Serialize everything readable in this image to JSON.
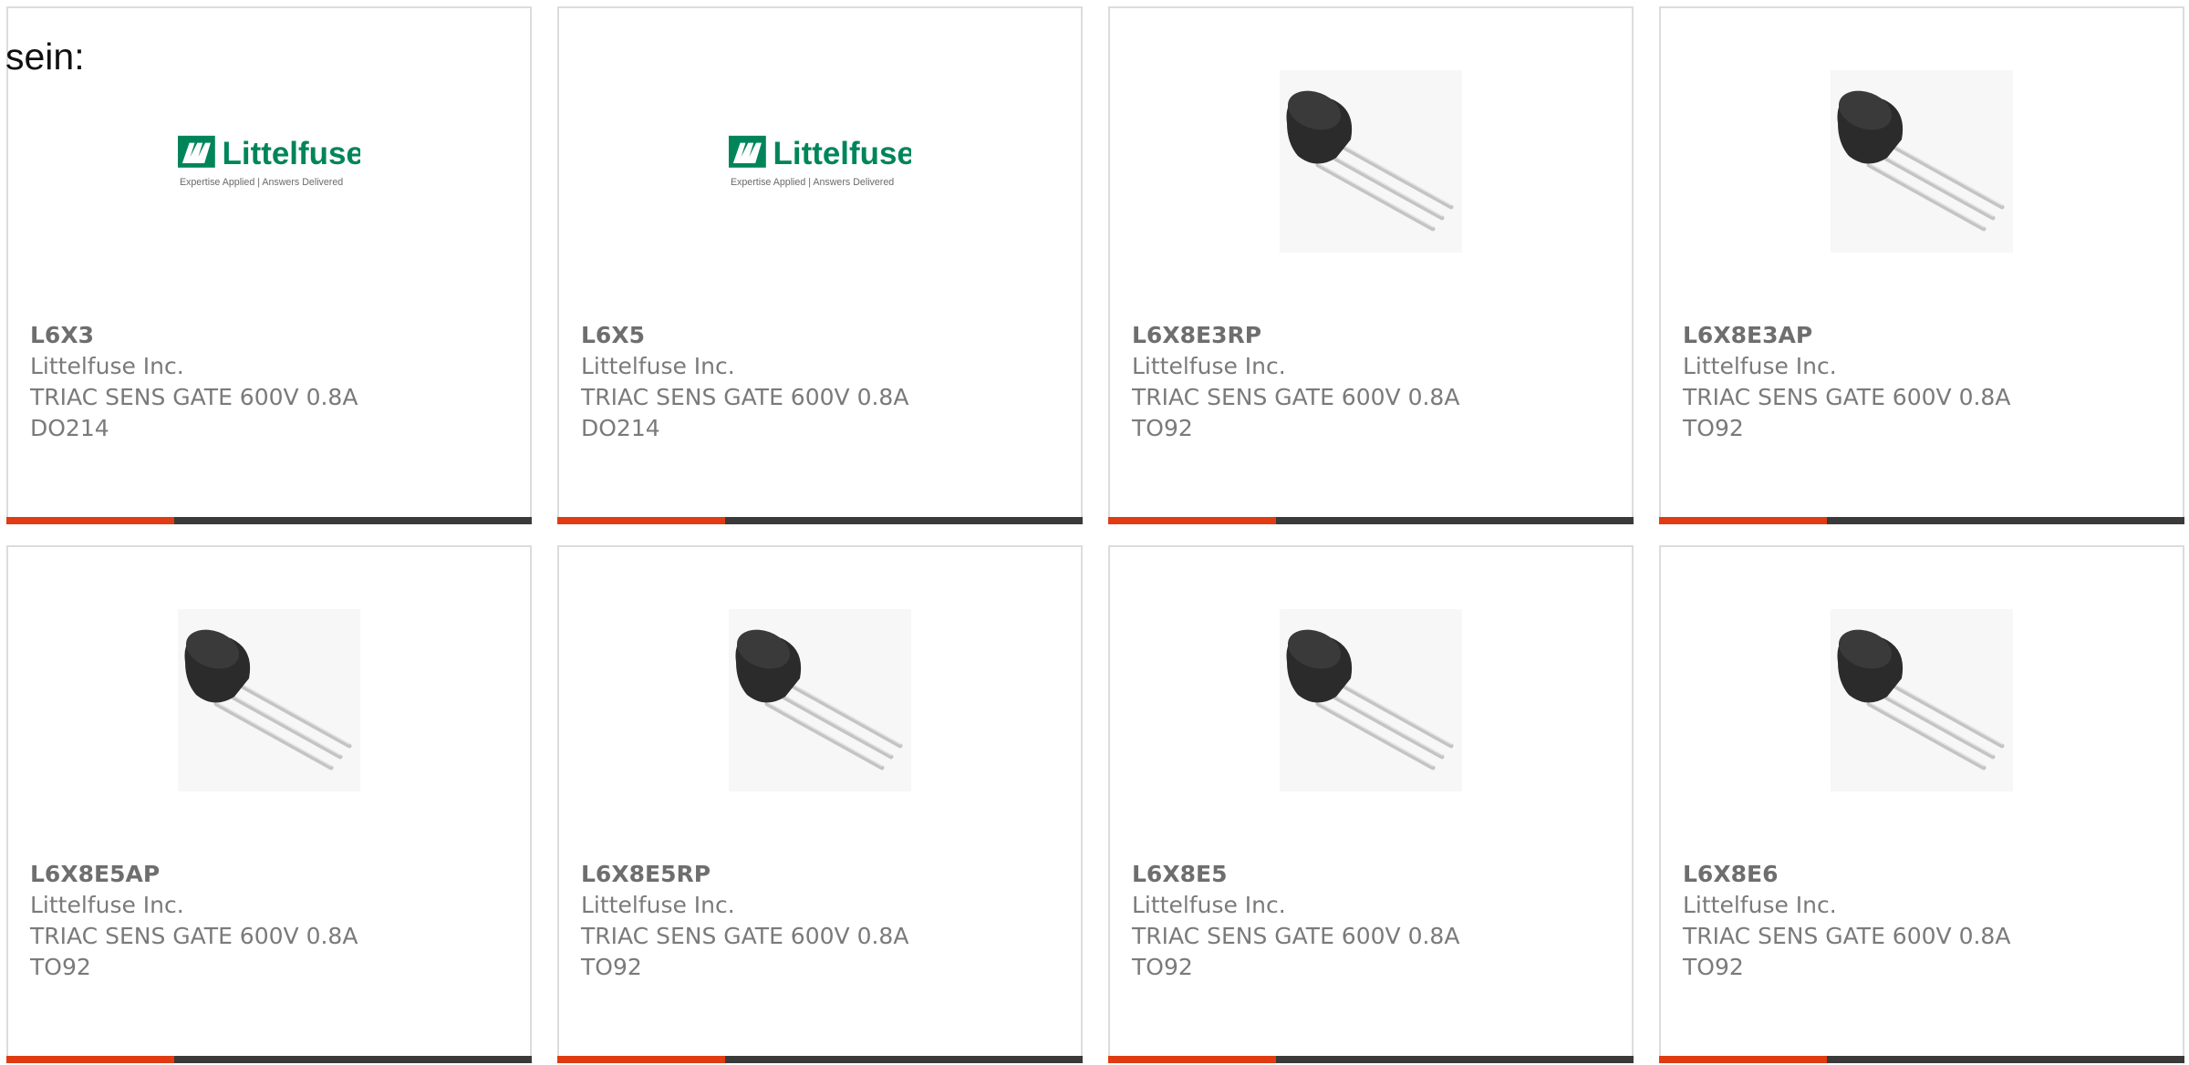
{
  "intro_text": "sein:",
  "logo": {
    "brand": "Littelfuse",
    "tagline": "Expertise Applied | Answers Delivered",
    "color": "#00855b"
  },
  "colors": {
    "accent_bar": "#e03b12",
    "dark_bar": "#3a3a3a",
    "border": "#dcdcdc",
    "text": "#7a7a7a"
  },
  "products": [
    {
      "part": "L6X3",
      "maker": "Littelfuse Inc.",
      "desc": "TRIAC SENS GATE 600V 0.8A",
      "pkg": "DO214",
      "image": "littelfuse-logo"
    },
    {
      "part": "L6X5",
      "maker": "Littelfuse Inc.",
      "desc": "TRIAC SENS GATE 600V 0.8A",
      "pkg": "DO214",
      "image": "littelfuse-logo"
    },
    {
      "part": "L6X8E3RP",
      "maker": "Littelfuse Inc.",
      "desc": "TRIAC SENS GATE 600V 0.8A",
      "pkg": "TO92",
      "image": "to92-transistor-icon"
    },
    {
      "part": "L6X8E3AP",
      "maker": "Littelfuse Inc.",
      "desc": "TRIAC SENS GATE 600V 0.8A",
      "pkg": "TO92",
      "image": "to92-transistor-icon"
    },
    {
      "part": "L6X8E5AP",
      "maker": "Littelfuse Inc.",
      "desc": "TRIAC SENS GATE 600V 0.8A",
      "pkg": "TO92",
      "image": "to92-transistor-icon"
    },
    {
      "part": "L6X8E5RP",
      "maker": "Littelfuse Inc.",
      "desc": "TRIAC SENS GATE 600V 0.8A",
      "pkg": "TO92",
      "image": "to92-transistor-icon"
    },
    {
      "part": "L6X8E5",
      "maker": "Littelfuse Inc.",
      "desc": "TRIAC SENS GATE 600V 0.8A",
      "pkg": "TO92",
      "image": "to92-transistor-icon"
    },
    {
      "part": "L6X8E6",
      "maker": "Littelfuse Inc.",
      "desc": "TRIAC SENS GATE 600V 0.8A",
      "pkg": "TO92",
      "image": "to92-transistor-icon"
    }
  ]
}
